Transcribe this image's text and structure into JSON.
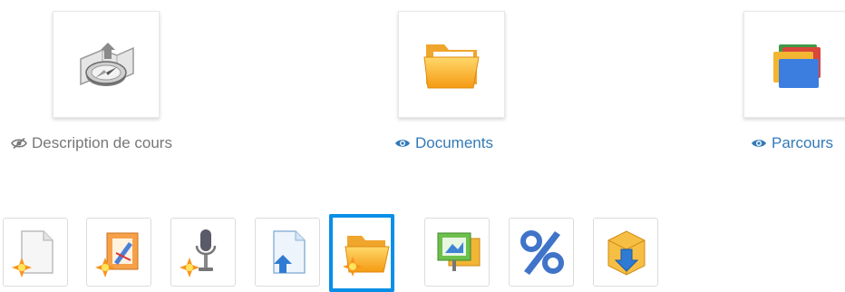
{
  "tiles": [
    {
      "label": "Description de cours",
      "icon": "compass-map-icon",
      "visibility_icon": "eye-slash-icon",
      "state": "hidden"
    },
    {
      "label": "Documents",
      "icon": "folder-icon",
      "visibility_icon": "eye-icon",
      "state": "visible"
    },
    {
      "label": "Parcours",
      "icon": "stacked-folders-icon",
      "visibility_icon": "eye-icon",
      "state": "visible"
    }
  ],
  "toolbar": {
    "items": [
      {
        "icon": "new-document-icon"
      },
      {
        "icon": "new-drawing-icon"
      },
      {
        "icon": "new-audio-recording-icon"
      },
      {
        "icon": "upload-to-document-icon"
      },
      {
        "icon": "new-folder-icon",
        "selected": true
      },
      {
        "icon": "slideshow-icon"
      },
      {
        "icon": "percent-quota-icon"
      },
      {
        "icon": "download-box-icon"
      }
    ]
  },
  "colors": {
    "link": "#337ab7",
    "muted": "#777777",
    "selection_border": "#0a8fe6"
  }
}
